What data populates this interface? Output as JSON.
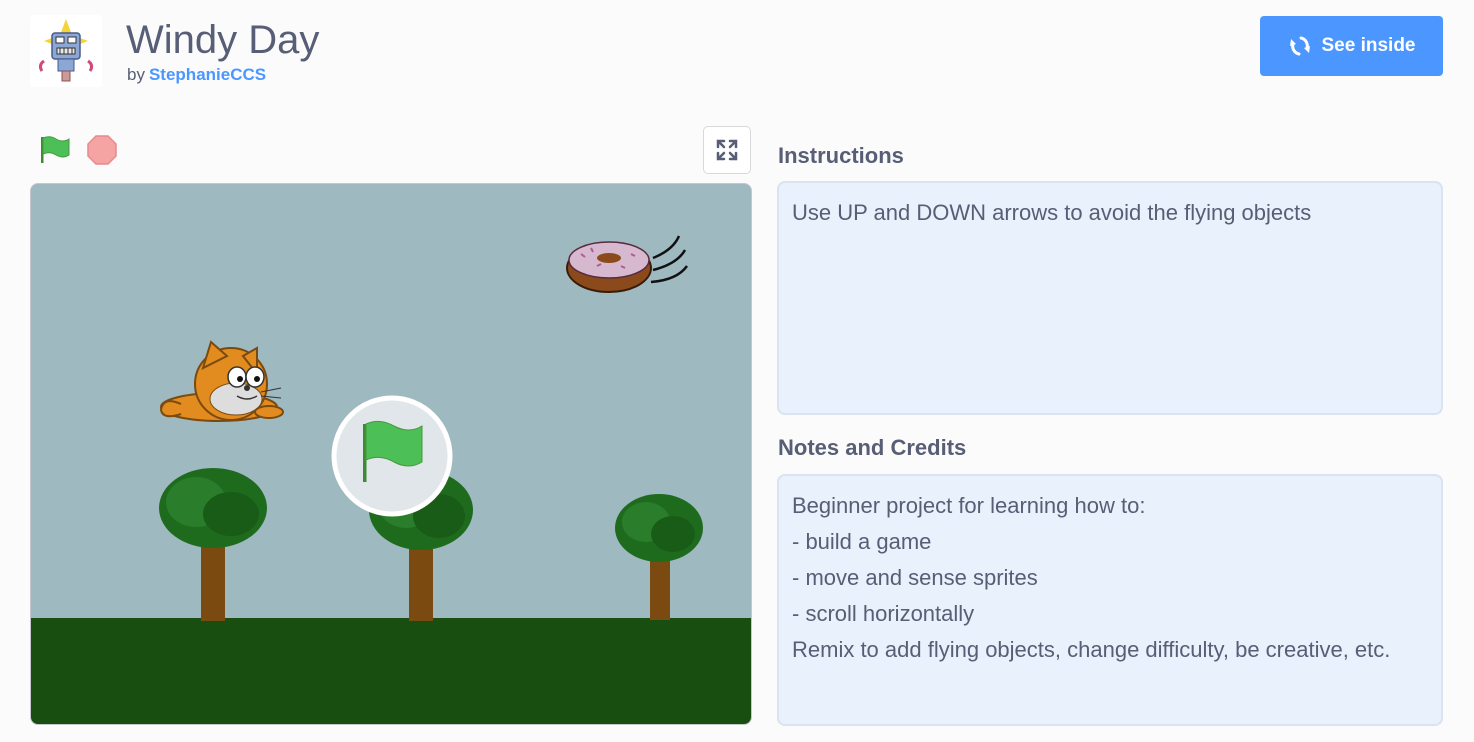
{
  "project": {
    "title": "Windy Day",
    "by_label": "by",
    "author": "StephanieCCS",
    "avatar_icon": "robot-avatar-icon"
  },
  "header": {
    "see_inside_label": "See inside",
    "see_inside_icon": "remix-arrows-icon"
  },
  "controls": {
    "green_flag_icon": "green-flag-icon",
    "stop_icon": "stop-sign-icon",
    "fullscreen_icon": "fullscreen-icon"
  },
  "stage": {
    "sprites": [
      "cat",
      "donut",
      "trees"
    ],
    "overlay_icon": "green-flag-icon"
  },
  "instructions": {
    "heading": "Instructions",
    "text": "Use UP and DOWN arrows to avoid the flying objects"
  },
  "notes": {
    "heading": "Notes and Credits",
    "lines": [
      "Beginner project for learning how to:",
      "- build a game",
      "- move and sense sprites",
      "- scroll horizontally",
      "Remix to add flying objects, change difficulty, be creative, etc."
    ]
  },
  "colors": {
    "accent": "#4c97ff",
    "text": "#575e75",
    "sky": "#9eb9c0",
    "grass": "#184f11",
    "box_bg": "#e9f1fc"
  }
}
